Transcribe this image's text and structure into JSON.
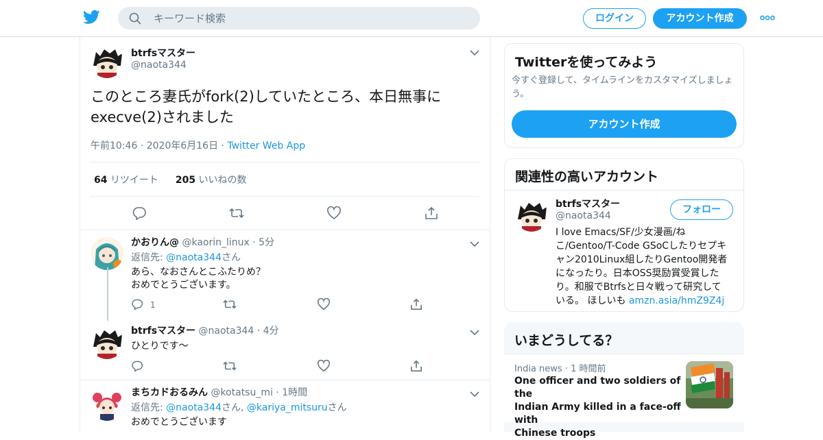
{
  "header": {
    "search_placeholder": "キーワード検索",
    "login_label": "ログイン",
    "signup_label": "アカウント作成",
    "brand_color": "#1da1f2"
  },
  "main_tweet": {
    "name": "btrfsマスター",
    "handle": "@naota344",
    "text_line1": "このところ妻氏がfork(2)していたところ、本日無事に",
    "text_line2": "execve(2)されました",
    "time": "午前10:46",
    "date": "2020年6月16日",
    "source": "Twitter Web App",
    "retweet_count": "64",
    "retweet_label": "リツイート",
    "like_count": "205",
    "like_label": "いいねの数"
  },
  "replies": [
    {
      "name": "かおりん@",
      "handle": "@kaorin_linux",
      "time": "5分",
      "reply_prefix": "返信先:",
      "reply_to": "@naota344",
      "reply_suffix": "さん",
      "line1": "あら、なおさんとこふたりめ？",
      "line2": "おめでとうございます。",
      "reply_count": "1"
    },
    {
      "name": "btrfsマスター",
      "handle": "@naota344",
      "time": "4分",
      "line1": "ひとりです〜"
    },
    {
      "name": "まちカドおるみん",
      "handle": "@kotatsu_mi",
      "time": "1時間",
      "reply_prefix": "返信先:",
      "reply_to": "@naota344",
      "reply_mid": "さん,",
      "reply_to2": "@kariya_mitsuru",
      "reply_suffix": "さん",
      "line1": "おめでとうございます"
    }
  ],
  "sidebar": {
    "try_card": {
      "title": "Twitterを使ってみよう",
      "sub_line1": "今すぐ登録して、タイムラインをカスタマイズしましょ",
      "sub_line2": "う。",
      "button": "アカウント作成"
    },
    "related_card": {
      "title": "関連性の高いアカウント",
      "name": "btrfsマスター",
      "handle": "@naota344",
      "follow_label": "フォロー",
      "bio_lines": [
        "I love Emacs/SF/少女漫画/ね",
        "こ/Gentoo/T-Code GSoCしたりセプキ",
        "ャン2010Linux組したりGentoo開発者",
        "になったり。日本OSS奨励賞受賞した",
        "り。和服でBtrfsと日々戦って研究して",
        "いる。 ほしいも"
      ],
      "bio_link": "amzn.asia/hmZ9Z4j"
    },
    "trends_card": {
      "title": "いまどうしてる？",
      "category": "India news",
      "time": "1 時間前",
      "headline_lines": [
        "One officer and two soldiers of the",
        "Indian Army killed in a face-off with",
        "Chinese troops"
      ]
    }
  }
}
